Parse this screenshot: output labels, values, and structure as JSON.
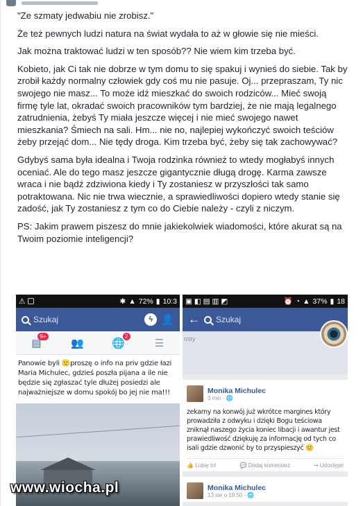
{
  "post": {
    "paragraphs": [
      "\"Ze szmaty jedwabiu nie zrobisz.\"",
      "Że też pewnych ludzi natura na świat wydała to aż w głowie się nie mieści.",
      "Jak można traktować ludzi w ten sposób?? Nie wiem kim trzeba być.",
      "Kobieto, jak Ci tak nie dobrze w tym domu to się spakuj i wynieś do siebie. Tak by zrobił każdy normalny człowiek gdy coś mu nie pasuje. Oj... przepraszam, Ty nic swojego nie masz... To może idź mieszkać do swoich rodziców... Mieć swoją firmę tyle lat, okradać swoich pracowników tym bardziej, że nie mają legalnego zatrudnienia, żebyś Ty miała jeszcze więcej i nie mieć swojego nawet mieszkania? Śmiech na sali. Hm... nie no, najlepiej wykończyć swoich teściów żeby przejąć dom... Nie tędy droga. Kim trzeba być, żeby się tak zachowywać?",
      "Gdybyś sama była idealna i Twoja rodzinka również to wtedy mogłabyś innych oceniać. Ale do tego masz jeszcze gigantycznie długą drogę. Karma zawsze wraca i nie bądź zdziwiona kiedy i Ty zostaniesz w przyszłości tak samo potraktowana. Nic nie trwa wiecznie, a sprawiedliwości dopiero wtedy stanie się zadość, jak Ty zostaniesz z tym co do Ciebie należy - czyli z niczym.",
      "PS: Jakim prawem piszesz do mnie jakiekolwiek wiadomości, które akurat są na Twoim poziomie inteligencji?"
    ]
  },
  "screenshot_left": {
    "status": {
      "battery": "72%",
      "time": "10:3"
    },
    "search_placeholder": "Szukaj",
    "badges": {
      "home": "9+",
      "notifications": "2"
    },
    "text": "Panowie byli 🙂proszę o info na priv gdzie łazi Maria Michulec, gdzieś poszła pijana a ile nie będzie się zgłaszać tyle dłużej posiedzi ale najważniejsze w domu spokój bo jej nie ma!!!"
  },
  "screenshot_right": {
    "status": {
      "battery": "37%",
      "time": "18"
    },
    "search_placeholder": "Szukaj",
    "cover_label": "osty",
    "post1": {
      "author": "Monika Michulec",
      "time": "3 min · ",
      "text": "zekamy na konwój już wkrótce margines który prowadziła z odwyku i dzięki Bogu teściowa zniknął naszego życia koniec libacji i awantur jest prawiedliwość dziękuję za informację od tych co isali gdzie dzwonić by to przyspieszyć 🙂",
      "actions": {
        "like": "Lubię to!",
        "comment": "Dodaj komentarz",
        "share": "Udostępn"
      }
    },
    "post2": {
      "author": "Monika Michulec",
      "time": "13 sie o 19:50 · "
    }
  },
  "watermark": "www.wiocha.pl"
}
